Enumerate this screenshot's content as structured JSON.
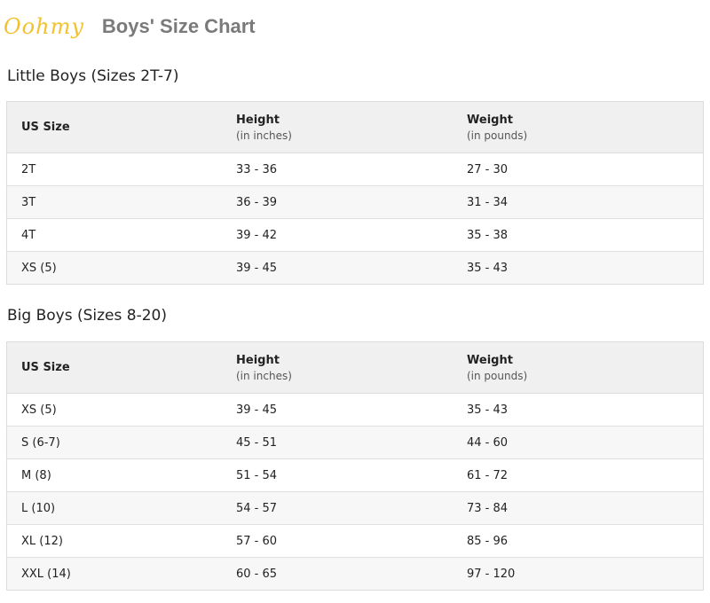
{
  "header": {
    "logo": "Oohmy",
    "title": "Boys' Size Chart"
  },
  "little_boys": {
    "title": "Little Boys (Sizes 2T-7)",
    "columns": {
      "size": "US Size",
      "height": "Height",
      "height_unit": "(in inches)",
      "weight": "Weight",
      "weight_unit": "(in pounds)"
    },
    "rows": [
      {
        "size": "2T",
        "height": "33 - 36",
        "weight": "27 - 30"
      },
      {
        "size": "3T",
        "height": "36 - 39",
        "weight": "31 - 34"
      },
      {
        "size": "4T",
        "height": "39 - 42",
        "weight": "35 - 38"
      },
      {
        "size": "XS (5)",
        "height": "39 - 45",
        "weight": "35 - 43"
      }
    ]
  },
  "big_boys": {
    "title": "Big Boys (Sizes 8-20)",
    "columns": {
      "size": "US Size",
      "height": "Height",
      "height_unit": "(in inches)",
      "weight": "Weight",
      "weight_unit": "(in pounds)"
    },
    "rows": [
      {
        "size": "XS (5)",
        "height": "39 - 45",
        "weight": "35 - 43"
      },
      {
        "size": "S (6-7)",
        "height": "45 - 51",
        "weight": "44 - 60"
      },
      {
        "size": "M (8)",
        "height": "51 - 54",
        "weight": "61 - 72"
      },
      {
        "size": "L (10)",
        "height": "54 - 57",
        "weight": "73 - 84"
      },
      {
        "size": "XL (12)",
        "height": "57 - 60",
        "weight": "85 - 96"
      },
      {
        "size": "XXL (14)",
        "height": "60 - 65",
        "weight": "97 - 120"
      }
    ]
  }
}
